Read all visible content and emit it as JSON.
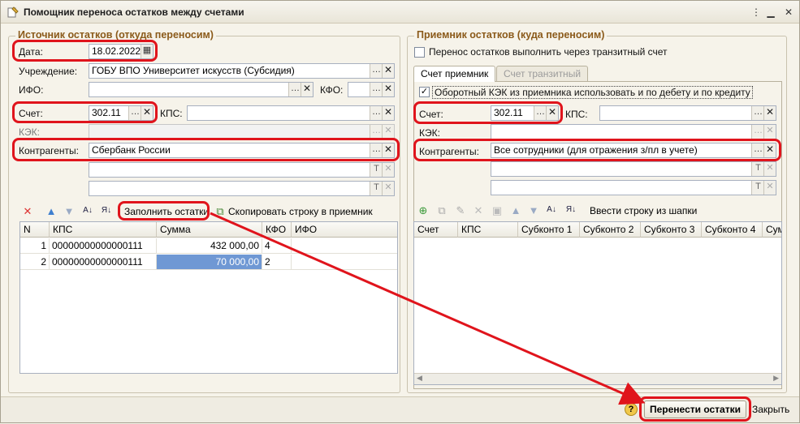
{
  "window": {
    "title": "Помощник переноса остатков между счетами"
  },
  "source": {
    "title": "Источник остатков (откуда переносим)",
    "date_label": "Дата:",
    "date_value": "18.02.2022",
    "institution_label": "Учреждение:",
    "institution_value": "ГОБУ ВПО Университет искусств (Субсидия)",
    "ifo_label": "ИФО:",
    "kfo_label": "КФО:",
    "account_label": "Счет:",
    "account_value": "302.11",
    "kps_label": "КПС:",
    "kek_label": "КЭК:",
    "counterparty_label": "Контрагенты:",
    "counterparty_value": "Сбербанк России",
    "toolbar": {
      "fill_label": "Заполнить остатки",
      "copy_label": "Скопировать строку в приемник"
    },
    "table": {
      "columns": [
        "N",
        "КПС",
        "Сумма",
        "КФО",
        "ИФО"
      ],
      "rows": [
        {
          "n": "1",
          "kps": "00000000000000111",
          "sum": "432 000,00",
          "kfo": "4",
          "ifo": ""
        },
        {
          "n": "2",
          "kps": "00000000000000111",
          "sum": "70 000,00",
          "kfo": "2",
          "ifo": ""
        }
      ]
    }
  },
  "target": {
    "title": "Приемник остатков (куда переносим)",
    "transit_checkbox_label": "Перенос остатков выполнить через транзитный счет",
    "tabs": [
      "Счет приемник",
      "Счет транзитный"
    ],
    "kek_checkbox_label": "Оборотный КЭК из приемника использовать и по дебету и по кредиту",
    "account_label": "Счет:",
    "account_value": "302.11",
    "kps_label": "КПС:",
    "kek_label": "КЭК:",
    "counterparty_label": "Контрагенты:",
    "counterparty_value": "Все сотрудники (для отражения з/пл в учете)",
    "toolbar": {
      "enter_row_label": "Ввести строку из шапки"
    },
    "table": {
      "columns": [
        "Счет",
        "КПС",
        "Субконто 1",
        "Субконто 2",
        "Субконто 3",
        "Субконто 4",
        "Сум"
      ]
    }
  },
  "footer": {
    "transfer_label": "Перенести остатки",
    "close_label": "Закрыть"
  },
  "colors": {
    "highlight": "#e0141c",
    "group_title": "#8b5a1a",
    "selection": "#6f98d4"
  }
}
